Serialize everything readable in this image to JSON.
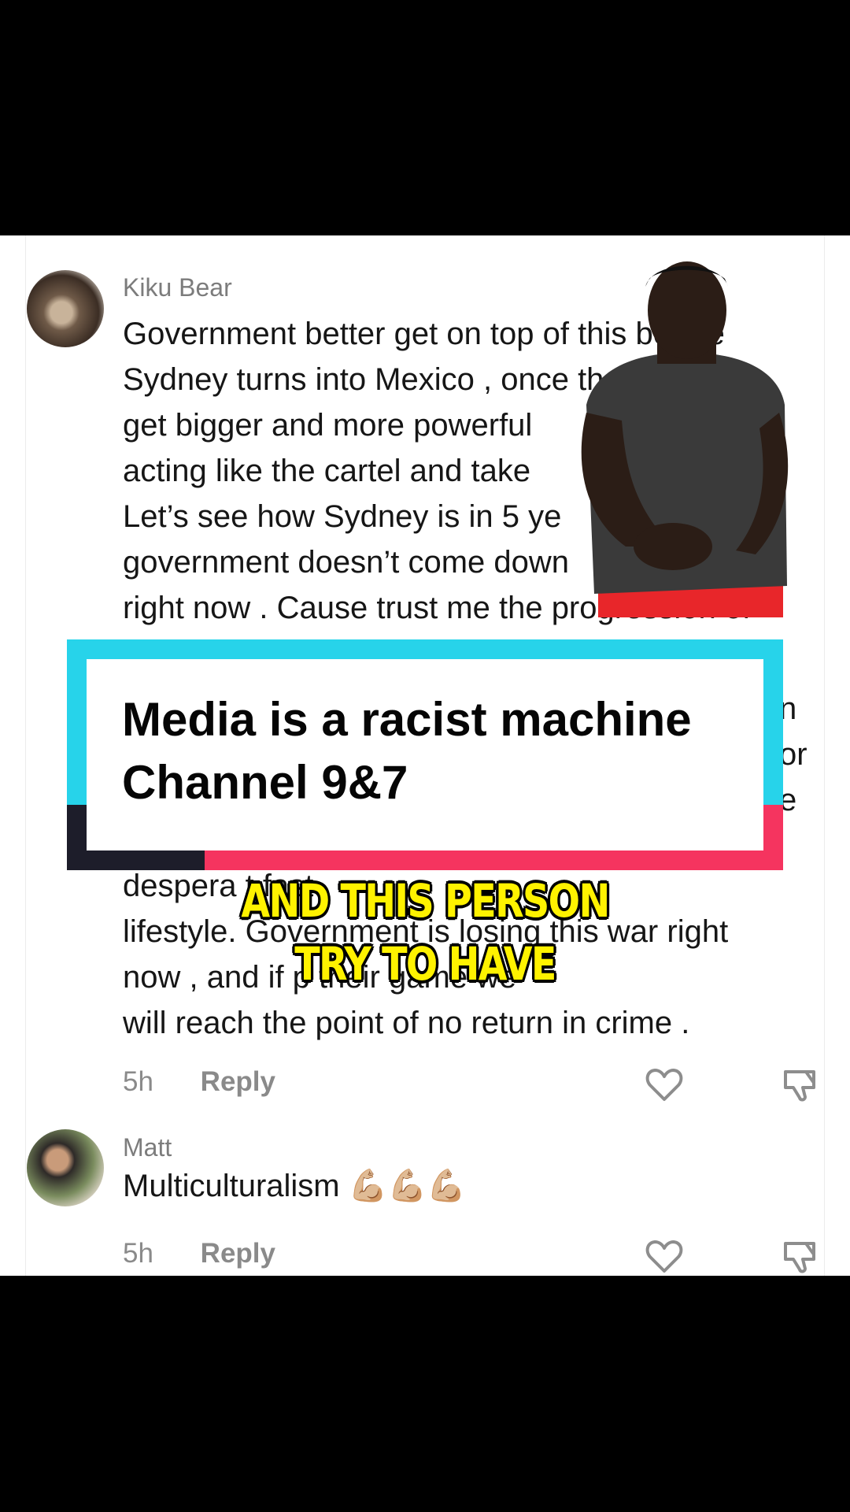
{
  "comments": [
    {
      "username": "Kiku Bear",
      "text_before_overlay": "Government better get on top of this before\nSydney turns into Mexico , once these gangs\nget bigger and more powerful\nacting like the cartel and take\nLet’s see how Sydney is in 5 ye\ngovernment doesn’t come down\nright now . Cause trust me the progression of",
      "overlay_right_fragments": [
        "n",
        "or",
        "e"
      ],
      "text_after_overlay": "despera                     t fast\nlifestyle. Government is losing this war right\nnow , and if                     p their game we\nwill reach the point of no return in crime .",
      "time": "5h",
      "reply_label": "Reply"
    },
    {
      "username": "Matt",
      "text": "Multiculturalism 💪🏼💪🏼💪🏼",
      "time": "5h",
      "reply_label": "Reply"
    }
  ],
  "title_card": {
    "line1": "Media is a racist machine",
    "line2": "Channel 9&7"
  },
  "captions": {
    "line1": "AND THIS PERSON",
    "line2": "TRY TO HAVE"
  },
  "icons": [
    "heart-icon",
    "dislike-icon"
  ],
  "colors": {
    "cyan": "#27d3ea",
    "red": "#f5345f",
    "dark": "#1d1d2a",
    "caption": "#fff200"
  }
}
